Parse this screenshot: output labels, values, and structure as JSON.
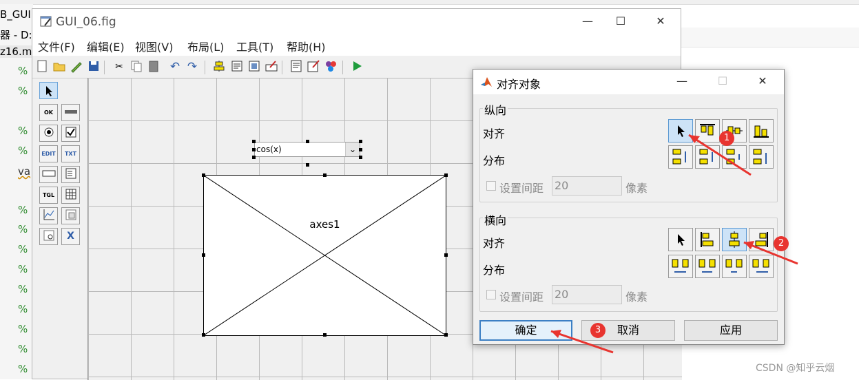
{
  "background": {
    "top_fragments": [
      "B_GUI",
      "器 - D:",
      "z16.m"
    ],
    "fragment_va": "va",
    "percent_sign": "%",
    "watermark": "CSDN @知乎云烟"
  },
  "guide": {
    "title": "GUI_06.fig",
    "menus": [
      "文件(F)",
      "编辑(E)",
      "视图(V)",
      "布局(L)",
      "工具(T)",
      "帮助(H)"
    ],
    "palette_labels": [
      "OK",
      "EDIT",
      "TXT",
      "TGL"
    ],
    "popup_value": "cos(x)",
    "axes_label": "axes1"
  },
  "align_dialog": {
    "title": "对齐对象",
    "vertical": {
      "group_label": "纵向",
      "align_label": "对齐",
      "distribute_label": "分布",
      "spacing_label": "设置间距",
      "spacing_value": "20",
      "unit": "像素"
    },
    "horizontal": {
      "group_label": "横向",
      "align_label": "对齐",
      "distribute_label": "分布",
      "spacing_label": "设置间距",
      "spacing_value": "20",
      "unit": "像素"
    },
    "buttons": {
      "ok": "确定",
      "cancel": "取消",
      "apply": "应用"
    }
  },
  "annotations": {
    "marker1": "1",
    "marker2": "2",
    "marker3": "3",
    "color": "#e8342f"
  }
}
